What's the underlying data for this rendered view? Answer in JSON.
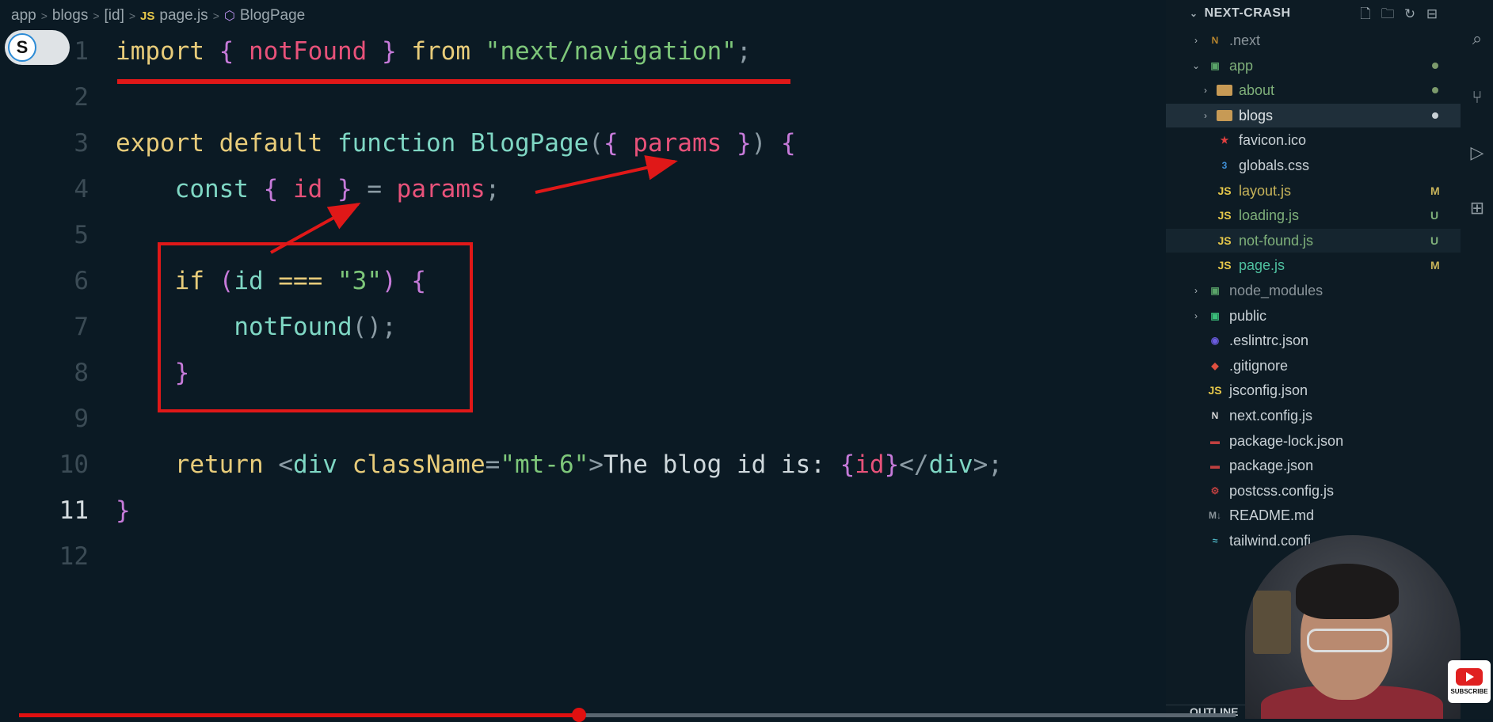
{
  "breadcrumb": {
    "segments": [
      "app",
      "blogs",
      "[id]"
    ],
    "file_badge": "JS",
    "file": "page.js",
    "symbol": "BlogPage"
  },
  "toggle": {
    "label": "S"
  },
  "editor": {
    "active_line": 11,
    "lines": [
      {
        "n": "1",
        "tokens": [
          [
            "kw",
            "import"
          ],
          [
            "pn",
            " "
          ],
          [
            "br",
            "{"
          ],
          [
            "pn",
            " "
          ],
          [
            "var",
            "notFound"
          ],
          [
            "pn",
            " "
          ],
          [
            "br",
            "}"
          ],
          [
            "pn",
            " "
          ],
          [
            "kw",
            "from"
          ],
          [
            "pn",
            " "
          ],
          [
            "str",
            "\"next/navigation\""
          ],
          [
            "pn",
            ";"
          ]
        ]
      },
      {
        "n": "2",
        "tokens": []
      },
      {
        "n": "3",
        "tokens": [
          [
            "kw",
            "export"
          ],
          [
            "pn",
            " "
          ],
          [
            "kw",
            "default"
          ],
          [
            "pn",
            " "
          ],
          [
            "fn",
            "function"
          ],
          [
            "pn",
            " "
          ],
          [
            "fn",
            "BlogPage"
          ],
          [
            "pn",
            "("
          ],
          [
            "br",
            "{"
          ],
          [
            "pn",
            " "
          ],
          [
            "var",
            "params"
          ],
          [
            "pn",
            " "
          ],
          [
            "br",
            "}"
          ],
          [
            "pn",
            ")"
          ],
          [
            "pn",
            " "
          ],
          [
            "br",
            "{"
          ]
        ]
      },
      {
        "n": "4",
        "tokens": [
          [
            "pn",
            "    "
          ],
          [
            "fn",
            "const"
          ],
          [
            "pn",
            " "
          ],
          [
            "br",
            "{"
          ],
          [
            "pn",
            " "
          ],
          [
            "var",
            "id"
          ],
          [
            "pn",
            " "
          ],
          [
            "br",
            "}"
          ],
          [
            "pn",
            " = "
          ],
          [
            "var",
            "params"
          ],
          [
            "pn",
            ";"
          ]
        ]
      },
      {
        "n": "5",
        "tokens": []
      },
      {
        "n": "6",
        "tokens": [
          [
            "pn",
            "    "
          ],
          [
            "kw",
            "if"
          ],
          [
            "pn",
            " "
          ],
          [
            "br",
            "("
          ],
          [
            "fn",
            "id"
          ],
          [
            "pn",
            " "
          ],
          [
            "kw",
            "==="
          ],
          [
            "pn",
            " "
          ],
          [
            "str",
            "\"3\""
          ],
          [
            "br",
            ")"
          ],
          [
            "pn",
            " "
          ],
          [
            "br",
            "{"
          ]
        ]
      },
      {
        "n": "7",
        "tokens": [
          [
            "pn",
            "        "
          ],
          [
            "fn",
            "notFound"
          ],
          [
            "pn",
            "();"
          ]
        ]
      },
      {
        "n": "8",
        "tokens": [
          [
            "pn",
            "    "
          ],
          [
            "br",
            "}"
          ]
        ]
      },
      {
        "n": "9",
        "tokens": []
      },
      {
        "n": "10",
        "tokens": [
          [
            "pn",
            "    "
          ],
          [
            "kw",
            "return"
          ],
          [
            "pn",
            " "
          ],
          [
            "pn",
            "<"
          ],
          [
            "tg",
            "div"
          ],
          [
            "pn",
            " "
          ],
          [
            "at",
            "className"
          ],
          [
            "pn",
            "="
          ],
          [
            "str",
            "\"mt-6\""
          ],
          [
            "pn",
            ">"
          ],
          [
            "tx",
            "The blog id is: "
          ],
          [
            "br",
            "{"
          ],
          [
            "var",
            "id"
          ],
          [
            "br",
            "}"
          ],
          [
            "pn",
            "</"
          ],
          [
            "tg",
            "div"
          ],
          [
            "pn",
            ">;"
          ]
        ]
      },
      {
        "n": "11",
        "tokens": [
          [
            "br",
            "}"
          ]
        ]
      },
      {
        "n": "12",
        "tokens": []
      }
    ]
  },
  "explorer": {
    "title": "NEXT-CRASH",
    "items": [
      {
        "label": ".next",
        "depth": 0,
        "chev": "›",
        "icon": "N",
        "icon_color": "#b8862e",
        "text_color": "#8a949a",
        "mark": ""
      },
      {
        "label": "app",
        "depth": 0,
        "chev": "⌄",
        "icon": "▣",
        "icon_color": "#5aa469",
        "text_color": "#7fb07a",
        "mark": "dot"
      },
      {
        "label": "about",
        "depth": 1,
        "chev": "›",
        "icon": "folder",
        "icon_color": "#c79a55",
        "text_color": "#7fb07a",
        "mark": "dot"
      },
      {
        "label": "blogs",
        "depth": 1,
        "chev": "›",
        "icon": "folder",
        "icon_color": "#c79a55",
        "text_color": "#dfe5e8",
        "mark": "dot-white",
        "state": "selected"
      },
      {
        "label": "favicon.ico",
        "depth": 1,
        "chev": "",
        "icon": "★",
        "icon_color": "#e04040",
        "text_color": "#c9d1d6",
        "mark": ""
      },
      {
        "label": "globals.css",
        "depth": 1,
        "chev": "",
        "icon": "3",
        "icon_color": "#3f8fd6",
        "text_color": "#c9d1d6",
        "mark": ""
      },
      {
        "label": "layout.js",
        "depth": 1,
        "chev": "",
        "icon": "JS",
        "icon_color": "#e6c84a",
        "text_color": "#c8b45a",
        "mark": "M"
      },
      {
        "label": "loading.js",
        "depth": 1,
        "chev": "",
        "icon": "JS",
        "icon_color": "#e6c84a",
        "text_color": "#7fb07a",
        "mark": "U"
      },
      {
        "label": "not-found.js",
        "depth": 1,
        "chev": "",
        "icon": "JS",
        "icon_color": "#e6c84a",
        "text_color": "#7fb07a",
        "mark": "U",
        "state": "hover"
      },
      {
        "label": "page.js",
        "depth": 1,
        "chev": "",
        "icon": "JS",
        "icon_color": "#e6c84a",
        "text_color": "#4fc1a0",
        "mark": "M"
      },
      {
        "label": "node_modules",
        "depth": 0,
        "chev": "›",
        "icon": "▣",
        "icon_color": "#5aa469",
        "text_color": "#8a949a",
        "mark": ""
      },
      {
        "label": "public",
        "depth": 0,
        "chev": "›",
        "icon": "▣",
        "icon_color": "#3bbf7a",
        "text_color": "#c9d1d6",
        "mark": ""
      },
      {
        "label": ".eslintrc.json",
        "depth": 0,
        "chev": "",
        "icon": "◉",
        "icon_color": "#6b5ce0",
        "text_color": "#c9d1d6",
        "mark": ""
      },
      {
        "label": ".gitignore",
        "depth": 0,
        "chev": "",
        "icon": "◆",
        "icon_color": "#e05040",
        "text_color": "#c9d1d6",
        "mark": ""
      },
      {
        "label": "jsconfig.json",
        "depth": 0,
        "chev": "",
        "icon": "JS",
        "icon_color": "#e6c84a",
        "text_color": "#c9d1d6",
        "mark": ""
      },
      {
        "label": "next.config.js",
        "depth": 0,
        "chev": "",
        "icon": "N",
        "icon_color": "#d8d8d8",
        "text_color": "#c9d1d6",
        "mark": ""
      },
      {
        "label": "package-lock.json",
        "depth": 0,
        "chev": "",
        "icon": "▬",
        "icon_color": "#c04040",
        "text_color": "#c9d1d6",
        "mark": ""
      },
      {
        "label": "package.json",
        "depth": 0,
        "chev": "",
        "icon": "▬",
        "icon_color": "#c04040",
        "text_color": "#c9d1d6",
        "mark": ""
      },
      {
        "label": "postcss.config.js",
        "depth": 0,
        "chev": "",
        "icon": "⚙",
        "icon_color": "#c04040",
        "text_color": "#c9d1d6",
        "mark": ""
      },
      {
        "label": "README.md",
        "depth": 0,
        "chev": "",
        "icon": "M↓",
        "icon_color": "#8a949a",
        "text_color": "#c9d1d6",
        "mark": ""
      },
      {
        "label": "tailwind.confi",
        "depth": 0,
        "chev": "",
        "icon": "≈",
        "icon_color": "#4fb8c8",
        "text_color": "#c9d1d6",
        "mark": ""
      }
    ]
  },
  "outline": {
    "label": "OUTLINE"
  },
  "subscribe": {
    "label": "SUBSCRIBE"
  },
  "video": {
    "progress": 0.46
  }
}
